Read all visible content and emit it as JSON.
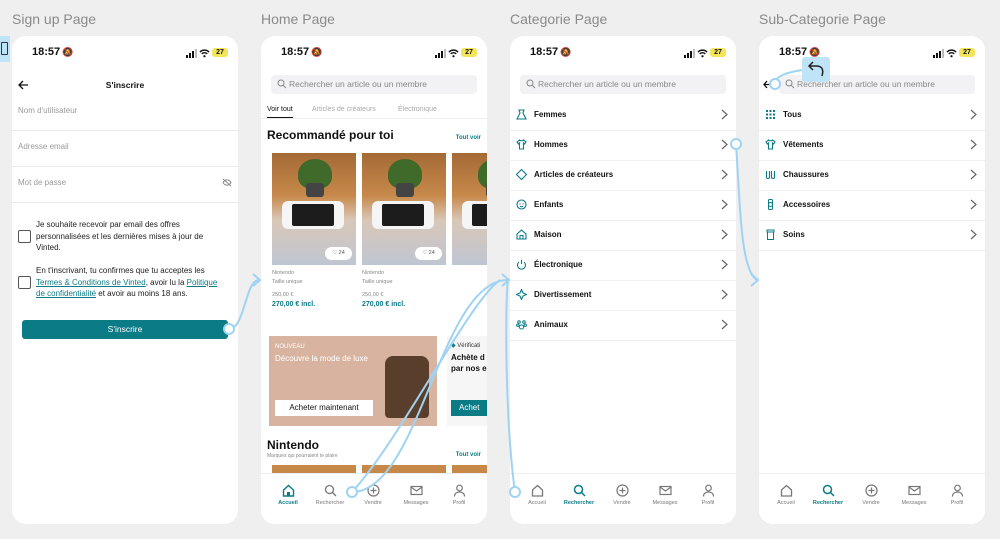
{
  "frames": {
    "signup": "Sign up Page",
    "home": "Home Page",
    "categorie": "Categorie Page",
    "subcategorie": "Sub-Categorie Page"
  },
  "status": {
    "time": "18:57",
    "battery": "27"
  },
  "search": {
    "placeholder": "Rechercher un article ou un membre"
  },
  "nav": {
    "accueil": "Accueil",
    "rechercher": "Rechercher",
    "vendre": "Vendre",
    "messages": "Messages",
    "profil": "Profil"
  },
  "signup": {
    "title": "S'inscrire",
    "username": "Nom d'utilisateur",
    "email": "Adresse email",
    "password": "Mot de passe",
    "newsletter": "Je souhaite recevoir par email des offres personnalisées et les dernières mises à jour de Vinted.",
    "terms_pre": "En t'inscrivant, tu confirmes que tu acceptes les",
    "terms_link": "Termes & Conditions de Vinted",
    "terms_mid": ", avoir lu la",
    "privacy_link": "Politique de confidentialité",
    "terms_post": "et avoir au moins 18 ans.",
    "button": "S'inscrire"
  },
  "home": {
    "tabs": [
      "Voir tout",
      "Articles de créateurs",
      "Électronique"
    ],
    "recommended": "Recommandé pour toi",
    "see_all": "Tout voir",
    "cards": [
      {
        "likes": "24",
        "brand": "Nintendo",
        "size": "Taille unique",
        "price": "250,00 €",
        "price_incl": "270,00 € incl."
      },
      {
        "likes": "24",
        "brand": "Nintendo",
        "size": "Taille unique",
        "price": "250,00 €",
        "price_incl": "270,00 € incl."
      }
    ],
    "promo": {
      "tag": "NOUVEAU",
      "headline": "Découvre la mode de luxe",
      "button": "Acheter maintenant"
    },
    "promo2": {
      "tag": "Vérificati",
      "text_1": "Achète d",
      "text_2": "par nos e",
      "button": "Achet"
    },
    "section2": "Nintendo",
    "section2_sub": "Marques qui pourraient te plaire",
    "section2_see_all": "Tout voir"
  },
  "categories": [
    "Femmes",
    "Hommes",
    "Articles de créateurs",
    "Enfants",
    "Maison",
    "Électronique",
    "Divertissement",
    "Animaux"
  ],
  "subcategories": [
    "Tous",
    "Vêtements",
    "Chaussures",
    "Accessoires",
    "Soins"
  ],
  "colors": {
    "accent": "#0b7b86",
    "flow": "#9fd3f2",
    "battery": "#f3e55b"
  }
}
